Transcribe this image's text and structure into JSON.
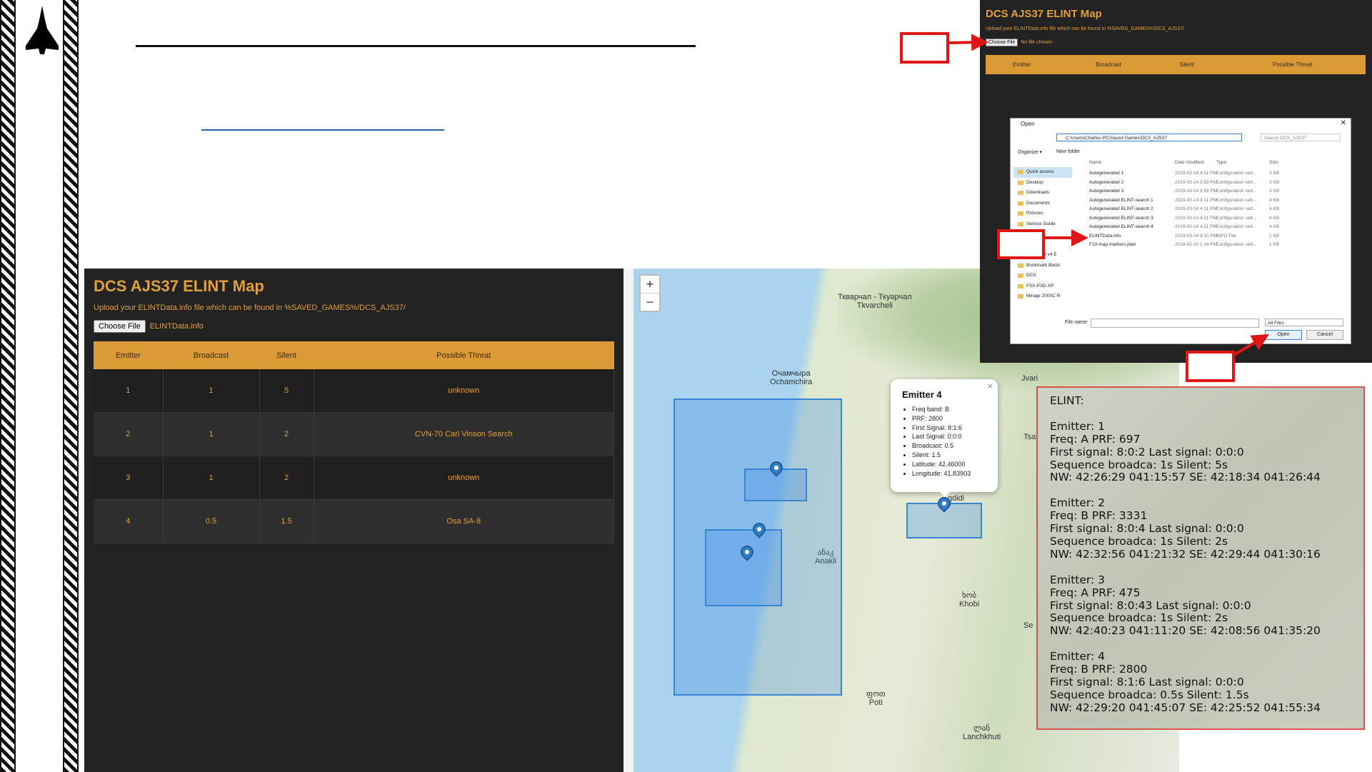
{
  "app": {
    "title": "DCS AJS37 ELINT Map",
    "subtitle": "Upload your ELINTData.info file which can be found in %SAVED_GAMES%/DCS_AJS37/",
    "choose_file": "Choose File",
    "file_name": "ELINTData.info",
    "columns": [
      "Emitter",
      "Broadcast",
      "Silent",
      "Possible Threat"
    ],
    "rows": [
      {
        "emitter": "1",
        "broadcast": "1",
        "silent": "5",
        "threat": "unknown"
      },
      {
        "emitter": "2",
        "broadcast": "1",
        "silent": "2",
        "threat": "CVN-70 Carl Vinson Search"
      },
      {
        "emitter": "3",
        "broadcast": "1",
        "silent": "2",
        "threat": "unknown"
      },
      {
        "emitter": "4",
        "broadcast": "0.5",
        "silent": "1.5",
        "threat": "Osa SA-8"
      }
    ]
  },
  "map": {
    "zoom_in": "+",
    "zoom_out": "−",
    "labels": {
      "tkvarcheli": "Ткварчал - Ткуарчал\nTkvarcheli",
      "ochamchira": "Очамчыра\nOchamchira",
      "jvari": "Jvari",
      "tsaleni": "Tsale",
      "zugdidi": "gdidi",
      "anaklia": "ანაკ\nAnakli",
      "khobi": "ხობ\nKhobi",
      "poti": "ფოთ\nPoti",
      "lanchkhuti": "ლან\nLanchkhuti",
      "se": "Se"
    },
    "popup": {
      "title": "Emitter 4",
      "close": "×",
      "items": [
        "Freq band: B",
        "PRF: 2800",
        "First Signal: 8:1:6",
        "Last Signal: 0:0:0",
        "Broadcast: 0.5",
        "Silent: 1.5",
        "Latitude: 42.46000",
        "Longitude: 41.83903"
      ]
    }
  },
  "screenshot": {
    "title": "DCS AJS37 ELINT Map",
    "subtitle": "Upload your ELINTData.info file which can be found in %SAVED_GAMES%/DCS_AJS37/",
    "choose_file": "Choose File",
    "file_name": "No file chosen",
    "columns": [
      "Emitter",
      "Broadcast",
      "Silent",
      "Possible Threat"
    ],
    "dialog": {
      "title": "Open",
      "close": "✕",
      "path": "C:\\Users\\Charles-PC\\Saved Games\\DCS_AJS37",
      "search": "Search DCS_AJS37",
      "organize": "Organize ▾",
      "new_folder": "New folder",
      "nav": [
        "Quick access",
        "Desktop",
        "Downloads",
        "Documents",
        "Pictures",
        "Various Guide",
        "Simula",
        "ampleR",
        "Prepar3D v4 E",
        "Bookmark Backi",
        "DCS",
        "FSX-P3D-XP",
        "Mirage 2000C R"
      ],
      "col_name": "Name",
      "col_date": "Date modified",
      "col_type": "Type",
      "col_size": "Size",
      "files": [
        {
          "name": "Autogenerated 1",
          "date": "2019-03-14 4:11 PM",
          "type": "Configuration sett...",
          "size": "3 KB"
        },
        {
          "name": "Autogenerated 2",
          "date": "2019-03-14 3:58 PM",
          "type": "Configuration sett...",
          "size": "3 KB"
        },
        {
          "name": "Autogenerated 3",
          "date": "2019-03-14 3:58 PM",
          "type": "Configuration sett...",
          "size": "3 KB"
        },
        {
          "name": "Autogenerated ELINT-search 1",
          "date": "2019-03-14 4:11 PM",
          "type": "Configuration sett...",
          "size": "4 KB"
        },
        {
          "name": "Autogenerated ELINT-search 2",
          "date": "2019-03-14 4:11 PM",
          "type": "Configuration sett...",
          "size": "4 KB"
        },
        {
          "name": "Autogenerated ELINT-search 3",
          "date": "2019-03-14 4:11 PM",
          "type": "Configuration sett...",
          "size": "4 KB"
        },
        {
          "name": "Autogenerated ELINT-search 4",
          "date": "2019-03-14 4:11 PM",
          "type": "Configuration sett...",
          "size": "4 KB"
        },
        {
          "name": "ELINTData.info",
          "date": "2019-03-14 4:10 PM",
          "type": "INFO File",
          "size": "1 KB"
        },
        {
          "name": "F10-map markers.plan",
          "date": "2018-02-20 1:14 PM",
          "type": "Configuration sett...",
          "size": "1 KB"
        }
      ],
      "file_name_label": "File name:",
      "filter": "All Files",
      "open": "Open",
      "cancel": "Cancel"
    }
  },
  "photo_text": "ELINT:\n\nEmitter: 1\nFreq: A PRF: 697\nFirst signal: 8:0:2 Last signal: 0:0:0\nSequence broadca: 1s Silent: 5s\nNW: 42:26:29 041:15:57 SE: 42:18:34 041:26:44\n\nEmitter: 2\nFreq: B PRF: 3331\nFirst signal: 8:0:4 Last signal: 0:0:0\nSequence broadca: 1s Silent: 2s\nNW: 42:32:56 041:21:32 SE: 42:29:44 041:30:16\n\nEmitter: 3\nFreq: A PRF: 475\nFirst signal: 8:0:43 Last signal: 0:0:0\nSequence broadca: 1s Silent: 2s\nNW: 42:40:23 041:11:20 SE: 42:08:56 041:35:20\n\nEmitter: 4\nFreq: B PRF: 2800\nFirst signal: 8:1:6 Last signal: 0:0:0\nSequence broadca: 0.5s Silent: 1.5s\nNW: 42:29:20 041:45:07 SE: 42:25:52 041:55:34",
  "colors": {
    "accent": "#dc9a34",
    "app_bg": "#222222",
    "callout": "#e01616",
    "region": "#3a84d6"
  }
}
